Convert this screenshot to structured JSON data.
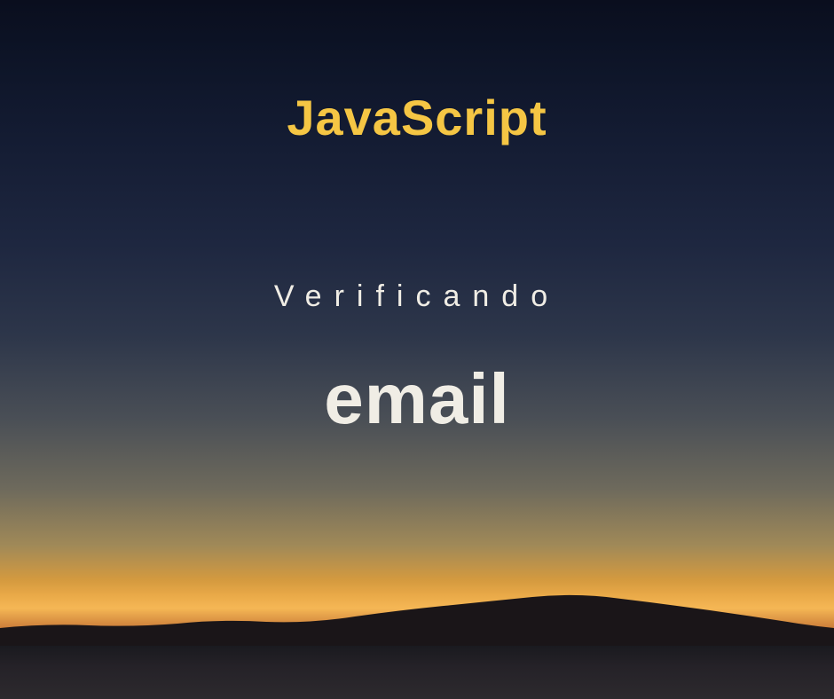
{
  "title": "JavaScript",
  "subtitle": "Verificando",
  "main_word": "email",
  "colors": {
    "title_color": "#f5c644",
    "text_color": "#f0ede5"
  }
}
